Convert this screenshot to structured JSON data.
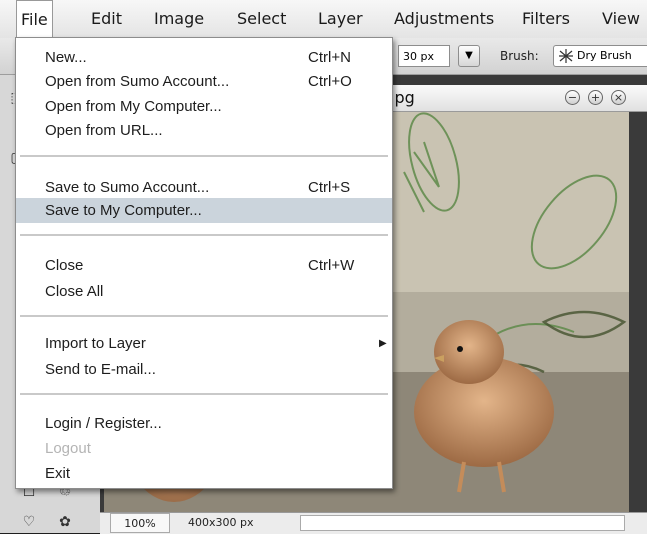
{
  "menubar": {
    "items": [
      "File",
      "Edit",
      "Image",
      "Select",
      "Layer",
      "Adjustments",
      "Filters",
      "View"
    ]
  },
  "toolbar": {
    "size_value": "30 px",
    "brush_label": "Brush:",
    "brush_value": "Dry Brush",
    "dropdown_icon": "triangle-down"
  },
  "document": {
    "title": "jpg",
    "zoom": "100%",
    "dimensions": "400x300 px"
  },
  "file_menu": {
    "new": {
      "label": "New...",
      "shortcut": "Ctrl+N"
    },
    "open_sumo": {
      "label": "Open from Sumo Account...",
      "shortcut": "Ctrl+O"
    },
    "open_computer": {
      "label": "Open from My Computer..."
    },
    "open_url": {
      "label": "Open from URL..."
    },
    "save_sumo": {
      "label": "Save to Sumo Account...",
      "shortcut": "Ctrl+S"
    },
    "save_computer": {
      "label": "Save to My Computer..."
    },
    "close": {
      "label": "Close",
      "shortcut": "Ctrl+W"
    },
    "close_all": {
      "label": "Close All"
    },
    "import_layer": {
      "label": "Import to Layer"
    },
    "send_email": {
      "label": "Send to E-mail..."
    },
    "login": {
      "label": "Login / Register..."
    },
    "logout": {
      "label": "Logout"
    },
    "exit": {
      "label": "Exit"
    }
  },
  "colors": {
    "menu_highlight": "#cbd4dc",
    "disabled_text": "#b4b4b4"
  }
}
